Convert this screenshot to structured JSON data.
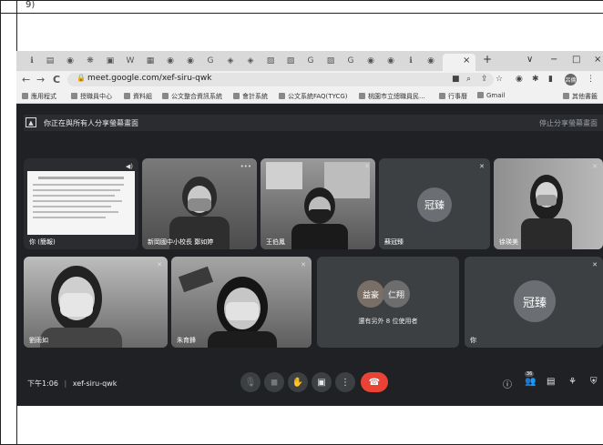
{
  "corner_text": "9)",
  "browser": {
    "tab_icons": [
      "ℹ",
      "▤",
      "◉",
      "❋",
      "▣",
      "W",
      "▦",
      "◉",
      "◉",
      "G",
      "◈",
      "◈",
      "▧",
      "▧",
      "G",
      "▨",
      "G",
      "◉",
      "◉",
      "ℹ",
      "◉"
    ],
    "active_tab_close": "×",
    "new_tab": "+",
    "window_controls": [
      "∨",
      "−",
      "□",
      "×"
    ],
    "back": "←",
    "forward": "→",
    "reload": "C",
    "url": "meet.google.com/xef-siru-qwk",
    "avatar_text": "呂倫"
  },
  "bookmarks": [
    {
      "label": "應用程式"
    },
    {
      "label": "授職員中心"
    },
    {
      "label": "資料組"
    },
    {
      "label": "公文整合資訊系統"
    },
    {
      "label": "會計系統"
    },
    {
      "label": "公文系統FAQ(TYCG)"
    },
    {
      "label": "桃園市立總職員民..."
    },
    {
      "label": "行事曆"
    },
    {
      "label": "Gmail"
    },
    {
      "label": "其他書籤"
    }
  ],
  "meet": {
    "presenting_text": "你正在與所有人分享螢幕畫面",
    "stop_presenting": "停止分享螢幕畫面",
    "row1": [
      {
        "name": "你 (簡報)",
        "kind": "screen"
      },
      {
        "name": "新岡國中小校長 鄭如婷",
        "kind": "video"
      },
      {
        "name": "王伯鳳",
        "kind": "video"
      },
      {
        "name": "蘇冠臻",
        "kind": "avatar",
        "avatar": "冠臻"
      },
      {
        "name": "徐瑛美",
        "kind": "video"
      }
    ],
    "row2": [
      {
        "name": "劉雨如",
        "kind": "video"
      },
      {
        "name": "朱育鋒",
        "kind": "video"
      },
      {
        "name": "還有另外 8 位使用者",
        "kind": "group",
        "avatars": [
          "益豪",
          "仁翔"
        ]
      },
      {
        "name": "你",
        "kind": "avatar",
        "avatar": "冠臻"
      }
    ],
    "clock": "下午1:06",
    "meeting_code": "xef-siru-qwk",
    "participant_count": "36"
  }
}
